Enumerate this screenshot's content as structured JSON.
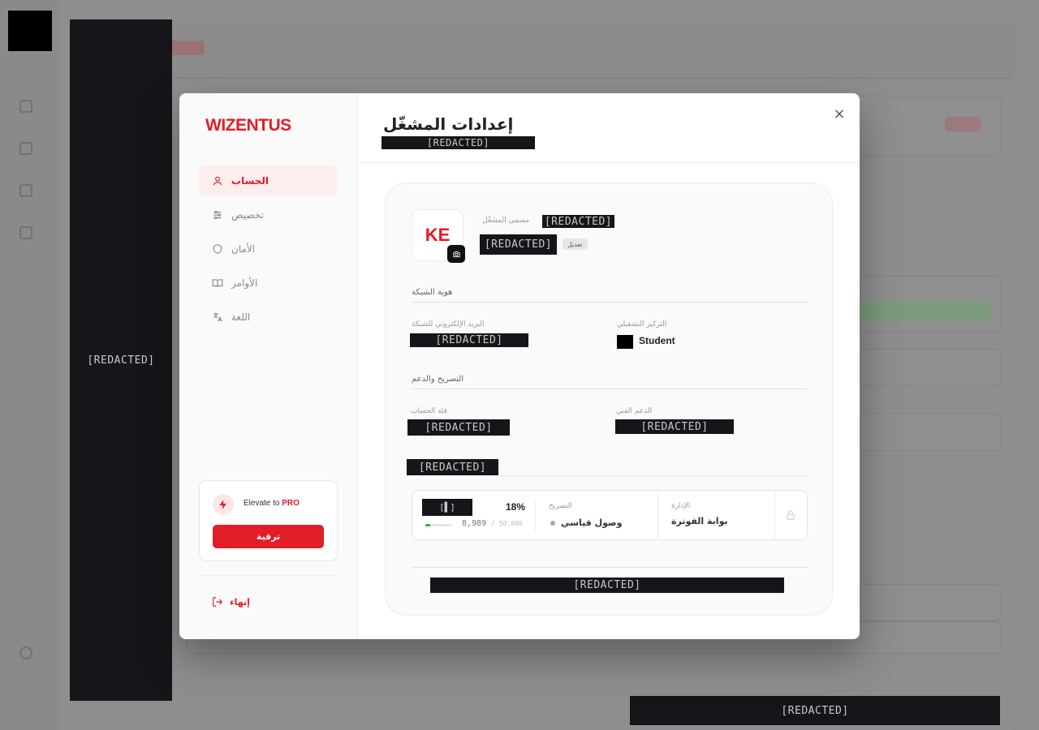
{
  "background": {
    "sidebar_redacted": "[REDACTED]",
    "bottom_redacted": "[REDACTED]"
  },
  "brand": "WIZENTUS",
  "nav": [
    {
      "label": "الحساب",
      "icon": "user-icon",
      "active": true
    },
    {
      "label": "تخصيص",
      "icon": "sliders-icon",
      "active": false
    },
    {
      "label": "الأمان",
      "icon": "shield-icon",
      "active": false
    },
    {
      "label": "الأوامر",
      "icon": "book-icon",
      "active": false
    },
    {
      "label": "اللغة",
      "icon": "translate-icon",
      "active": false
    }
  ],
  "promo": {
    "prefix": "Elevate to ",
    "highlight": "PRO",
    "button": "ترقية"
  },
  "logout_label": "إنهاء",
  "header": {
    "title": "إعدادات المشغّل",
    "subtitle": "[REDACTED]",
    "close": "×"
  },
  "profile": {
    "initials": "KE",
    "operator_label": "مسمى المشغّل",
    "operator_name": "[REDACTED]",
    "operator_id": "[REDACTED]",
    "edit_label": "تعديل"
  },
  "network_section": {
    "title": "هوية الشبكة",
    "email_label": "البريد الإلكتروني للشبكة",
    "email_value": "[REDACTED]",
    "focus_label": "التركيز التشغيلي",
    "focus_value": "Student"
  },
  "clearance_section": {
    "title": "التصريح والدعم",
    "category_label": "فئة الحساب",
    "category_value": "[REDACTED]",
    "support_label": "الدعم الفني",
    "support_value": "[REDACTED]"
  },
  "usage_section": {
    "title": "[REDACTED]",
    "toggle": "[▌]",
    "percent": "18%",
    "percent_value": 0.18,
    "used": "8,989",
    "limit": "/ 50,000",
    "clearance_label": "التصريح",
    "clearance_value": "وصول قياسي",
    "admin_label": "الإدارة",
    "admin_value": "بوابة الفوترة",
    "bar_color": "#2fb24a"
  },
  "footer_redacted": "[REDACTED]",
  "colors": {
    "accent": "#e11d27",
    "redaction": "#16161a"
  }
}
